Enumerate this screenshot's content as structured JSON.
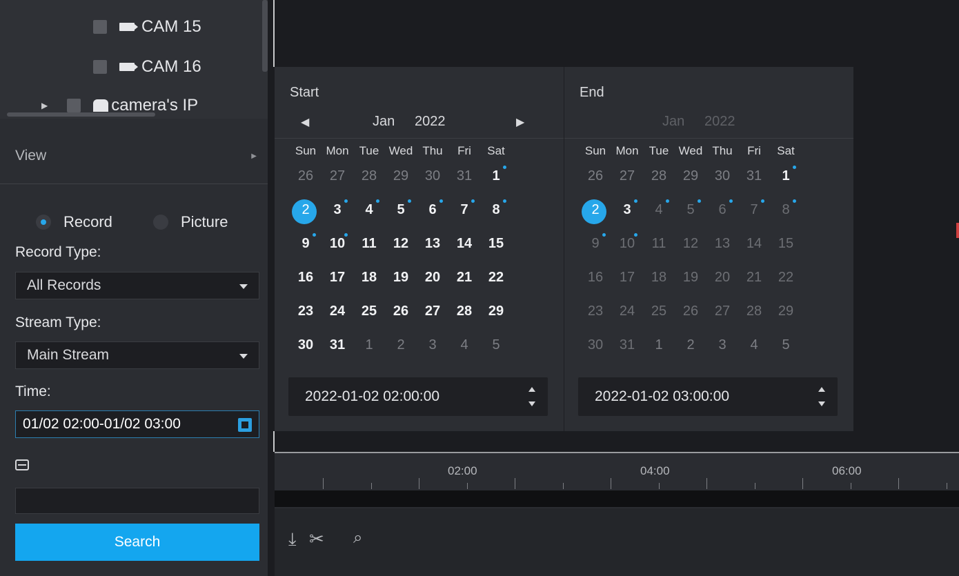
{
  "tree": {
    "items": [
      {
        "label": "CAM 15",
        "icon": "camera-icon"
      },
      {
        "label": "CAM 16",
        "icon": "camera-icon"
      },
      {
        "label": "camera's IP",
        "icon": "dome-camera-icon"
      }
    ]
  },
  "view": {
    "label": "View"
  },
  "mode": {
    "record_label": "Record",
    "picture_label": "Picture",
    "selected": "Record"
  },
  "record_type": {
    "label": "Record Type:",
    "value": "All Records"
  },
  "stream_type": {
    "label": "Stream Type:",
    "value": "Main Stream"
  },
  "time": {
    "label": "Time:",
    "value": "01/02 02:00-01/02 03:00"
  },
  "search": {
    "label": "Search"
  },
  "calendar": {
    "weekdays": [
      "Sun",
      "Mon",
      "Tue",
      "Wed",
      "Thu",
      "Fri",
      "Sat"
    ],
    "start": {
      "title": "Start",
      "month": "Jan",
      "year": "2022",
      "datetime": "2022-01-02 02:00:00"
    },
    "end": {
      "title": "End",
      "month": "Jan",
      "year": "2022",
      "datetime": "2022-01-02 03:00:00"
    },
    "days": [
      [
        "26",
        "27",
        "28",
        "29",
        "30",
        "31",
        "1"
      ],
      [
        "2",
        "3",
        "4",
        "5",
        "6",
        "7",
        "8"
      ],
      [
        "9",
        "10",
        "11",
        "12",
        "13",
        "14",
        "15"
      ],
      [
        "16",
        "17",
        "18",
        "19",
        "20",
        "21",
        "22"
      ],
      [
        "23",
        "24",
        "25",
        "26",
        "27",
        "28",
        "29"
      ],
      [
        "30",
        "31",
        "1",
        "2",
        "3",
        "4",
        "5"
      ]
    ],
    "selected_day": "2",
    "recorded_days": [
      "1",
      "2",
      "3",
      "4",
      "5",
      "6",
      "7",
      "8",
      "9",
      "10"
    ]
  },
  "timeline": {
    "labels": [
      "02:00",
      "04:00",
      "06:00"
    ]
  },
  "tools": [
    "download-icon",
    "scissors-icon",
    "zoom-icon"
  ],
  "colors": {
    "accent": "#14a6ef"
  }
}
